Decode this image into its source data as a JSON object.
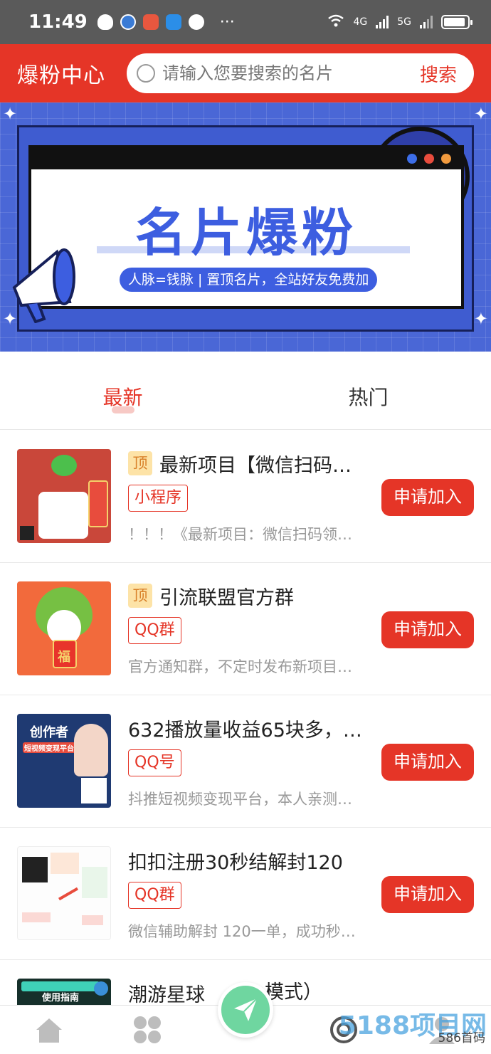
{
  "status_bar": {
    "time": "11:49",
    "network_1": "4G",
    "network_2": "5G",
    "more": "···"
  },
  "header": {
    "title": "爆粉中心",
    "search_placeholder": "请输入您要搜索的名片",
    "search_button": "搜索"
  },
  "banner": {
    "title": "名片爆粉",
    "slogan": "人脉=钱脉 | 置顶名片，全站好友免费加"
  },
  "tabs": [
    {
      "label": "最新",
      "active": true
    },
    {
      "label": "热门",
      "active": false
    }
  ],
  "items": [
    {
      "top_badge": "顶",
      "title": "最新项目【微信扫码…",
      "tag": "小程序",
      "desc": "！！！《最新项目：微信扫码领…",
      "button": "申请加入",
      "thumb_icon": "wechat-qr-thumbnail"
    },
    {
      "top_badge": "顶",
      "title": "引流联盟官方群",
      "tag": "QQ群",
      "desc": "官方通知群，不定时发布新项目…",
      "button": "申请加入",
      "thumb_icon": "frog-fortune-thumbnail",
      "thumb_text": "福"
    },
    {
      "top_badge": "",
      "title": "632播放量收益65块多，…",
      "tag": "QQ号",
      "desc": "抖推短视频变现平台，本人亲测…",
      "button": "申请加入",
      "thumb_icon": "creator-platform-thumbnail",
      "thumb_text": "创作者",
      "thumb_sub": "短视频变现平台"
    },
    {
      "top_badge": "",
      "title": "扣扣注册30秒结解封120",
      "tag": "QQ群",
      "desc": "微信辅助解封 120一单，成功秒…",
      "button": "申请加入",
      "thumb_icon": "unblock-guide-thumbnail"
    },
    {
      "top_badge": "",
      "title": "潮游星球",
      "title_tail": "模式）",
      "tag": "",
      "desc": "",
      "button": "",
      "thumb_icon": "planet-guide-thumbnail",
      "thumb_text": "使用指南"
    }
  ],
  "bottom_nav": [
    {
      "icon": "home-icon"
    },
    {
      "icon": "grid-icon"
    },
    {
      "icon": "send-icon"
    },
    {
      "icon": "target-icon"
    },
    {
      "icon": "profile-icon"
    }
  ],
  "watermark": {
    "text": "586首码",
    "logo": "5188项目网"
  },
  "colors": {
    "brand_red": "#e53527",
    "banner_blue": "#4a67d6",
    "fab_green": "#6fd6a0"
  }
}
